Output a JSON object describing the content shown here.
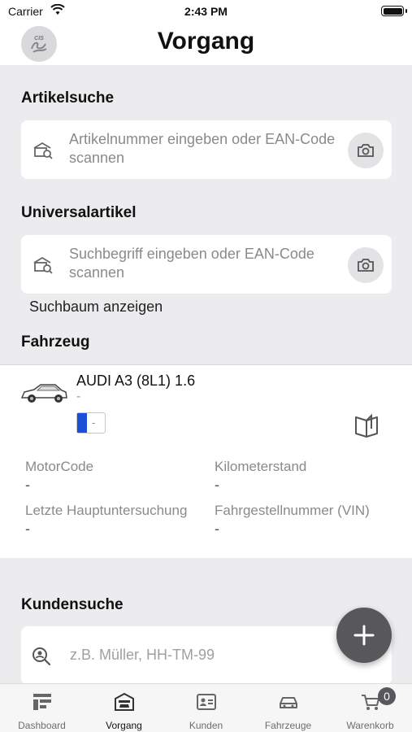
{
  "status_bar": {
    "carrier": "Carrier",
    "time": "2:43 PM"
  },
  "header": {
    "title": "Vorgang",
    "logo_text": "CIS"
  },
  "article_search": {
    "title": "Artikelsuche",
    "placeholder": "Artikelnummer eingeben oder EAN-Code scannen"
  },
  "universal_article": {
    "title": "Universalartikel",
    "placeholder": "Suchbegriff eingeben oder EAN-Code scannen",
    "tree_link": "Suchbaum anzeigen"
  },
  "vehicle": {
    "section_title": "Fahrzeug",
    "name": "AUDI A3 (8L1) 1.6",
    "subtitle": "-",
    "plate": "-",
    "fields": [
      {
        "label": "MotorCode",
        "value": "-"
      },
      {
        "label": "Kilometerstand",
        "value": "-"
      },
      {
        "label": "Letzte Hauptuntersuchung",
        "value": "-"
      },
      {
        "label": "Fahrgestellnummer (VIN)",
        "value": "-"
      }
    ]
  },
  "customer_search": {
    "title": "Kundensuche",
    "placeholder": "z.B. Müller, HH-TM-99"
  },
  "tabs": [
    {
      "label": "Dashboard",
      "icon": "dashboard-icon"
    },
    {
      "label": "Vorgang",
      "icon": "garage-icon"
    },
    {
      "label": "Kunden",
      "icon": "contact-card-icon"
    },
    {
      "label": "Fahrzeuge",
      "icon": "car-icon"
    },
    {
      "label": "Warenkorb",
      "icon": "cart-icon",
      "badge": "0"
    }
  ],
  "active_tab": "Vorgang",
  "colors": {
    "background": "#ececee",
    "card": "#ffffff",
    "fab": "#58585c",
    "eu_strip": "#1a4fd8"
  }
}
